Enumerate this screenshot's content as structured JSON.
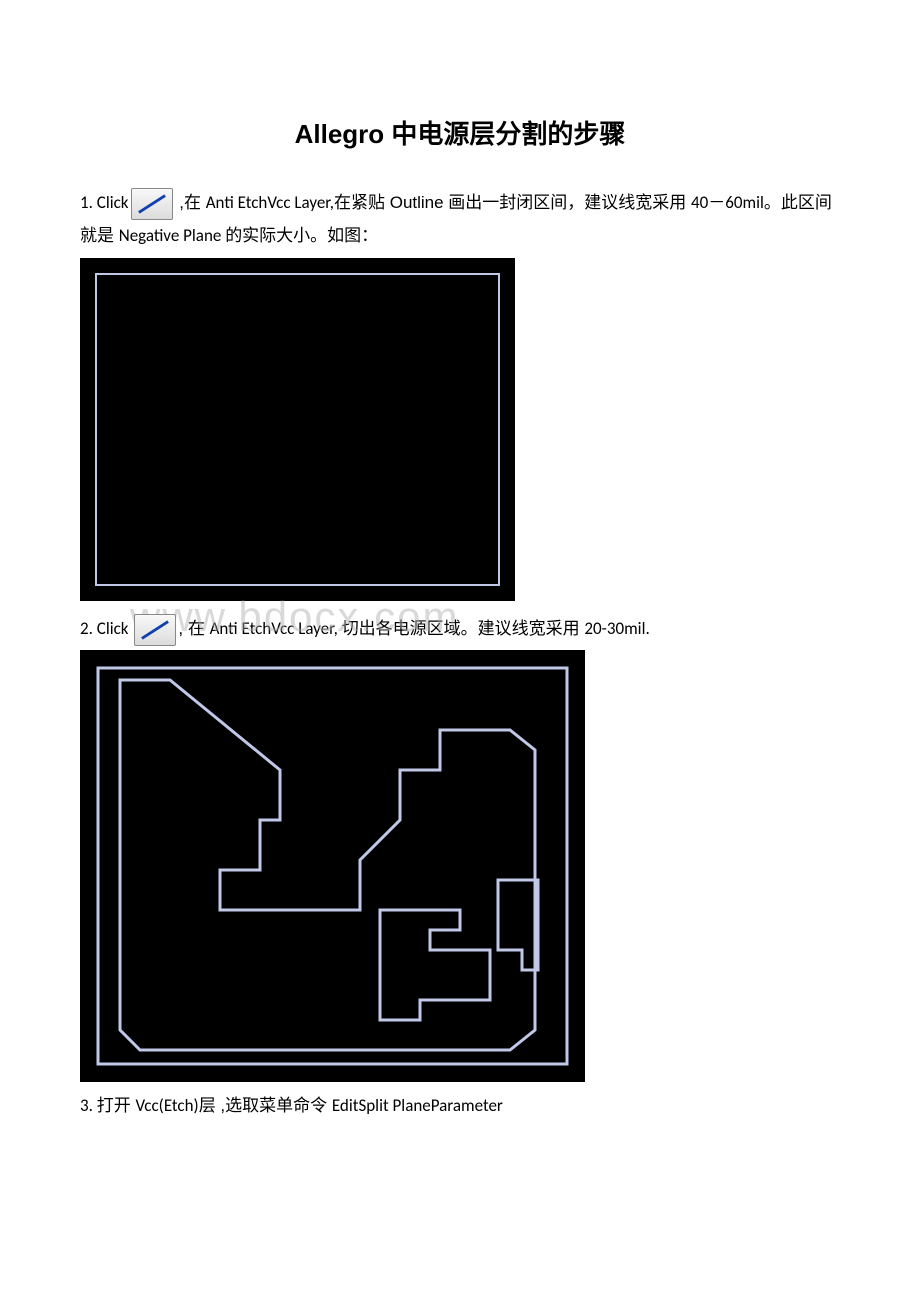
{
  "title": {
    "en_part": "Allegro ",
    "cn_part": "中电源层分割的步骤"
  },
  "step1": {
    "prefix": "1. Click",
    "after_icon_a": " ,在 ",
    "layer": "Anti EtchVcc Layer,",
    "mid_cn": "在紧贴 Outline 画出一封闭区间，建议线宽采用 ",
    "width_range": "40－60mil",
    "cn2": "。此区间就是 ",
    "plane": "Negative Plane ",
    "cn3": "的实际大小。如图："
  },
  "step2": {
    "prefix": "2. Click ",
    "after_icon": ", 在 ",
    "layer": "Anti EtchVcc Layer, ",
    "mid_cn": "切出各电源区域。建议线宽采用 ",
    "width_range": "20-30mil."
  },
  "watermark": "www.bdocx.com",
  "step3": {
    "prefix": "3. ",
    "cn1": "打开 ",
    "layer": "Vcc(Etch)",
    "cn2": "层 ,选取菜单命令 ",
    "cmd": "EditSplit PlaneParameter"
  }
}
